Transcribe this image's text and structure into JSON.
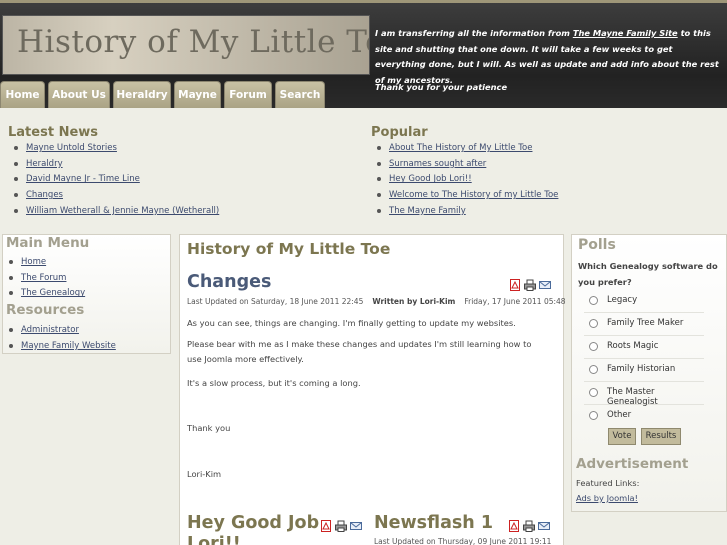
{
  "header": {
    "logo_text": "History of My Little Toe",
    "announce_pre": "I am transferring all the information from ",
    "announce_link": "The Mayne Family Site",
    "announce_post": " to this site and shutting that one down. It will take a few weeks to get everything done, but I will. As well as update and add info about the rest of my ancestors.",
    "thanks": "Thank you for your patience"
  },
  "nav": [
    "Home",
    "About Us",
    "Heraldry",
    "Mayne",
    "Forum",
    "Search"
  ],
  "latest_news": {
    "title": "Latest News",
    "items": [
      "Mayne Untold Stories",
      "Heraldry",
      "David Mayne Jr - Time Line",
      "Changes",
      "William Wetherall & Jennie Mayne (Wetherall)"
    ]
  },
  "popular": {
    "title": "Popular",
    "items": [
      "About The History of My Little Toe",
      "Surnames sought after",
      "Hey Good Job Lori!!",
      "Welcome to The History of my Little Toe",
      "The Mayne Family"
    ]
  },
  "main_menu": {
    "title": "Main Menu",
    "items": [
      "Home",
      "The Forum",
      "The Genealogy"
    ]
  },
  "resources": {
    "title": "Resources",
    "items": [
      "Administrator",
      "Mayne Family Website"
    ]
  },
  "center": {
    "title": "History of My Little Toe",
    "article": {
      "title": "Changes",
      "updated": "Last Updated on Saturday, 18 June 2011 22:45",
      "author": "Written by Lori-Kim",
      "date": "Friday, 17 June 2011 05:48",
      "p1": "As you can see, things are changing. I'm finally getting to update my websites.",
      "p2": "Please bear with me as I make these changes and updates I'm still learning how to use Joomla more effectively.",
      "p3": "It's a slow process, but it's coming a long.",
      "p4": "Thank you",
      "p5": "Lori-Kim"
    },
    "article2": {
      "title_line1": "Hey Good Job",
      "title_line2": "Lori!!"
    },
    "article3": {
      "title": "Newsflash 1",
      "updated": "Last Updated on Thursday, 09 June 2011 19:11"
    }
  },
  "polls": {
    "title": "Polls",
    "question": "Which Genealogy software do you prefer?",
    "options": [
      "Legacy",
      "Family Tree Maker",
      "Roots Magic",
      "Family Historian",
      "The Master Genealogist",
      "Other"
    ],
    "vote_label": "Vote",
    "results_label": "Results"
  },
  "ads": {
    "title": "Advertisement",
    "featured": "Featured Links:",
    "link": "Ads by Joomla!"
  }
}
